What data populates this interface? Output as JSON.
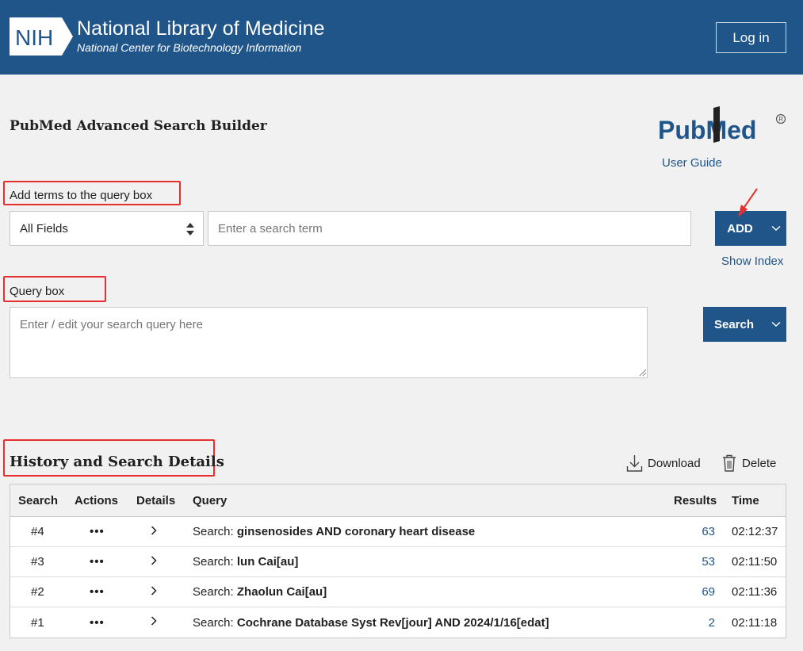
{
  "header": {
    "logo_text": "NIH",
    "title": "National Library of Medicine",
    "subtitle": "National Center for Biotechnology Information",
    "login_label": "Log in"
  },
  "page": {
    "title": "PubMed Advanced Search Builder",
    "logo_text": "PubMed",
    "user_guide_label": "User Guide"
  },
  "builder": {
    "add_terms_label": "Add terms to the query box",
    "field_value": "All Fields",
    "term_placeholder": "Enter a search term",
    "add_label": "ADD",
    "show_index_label": "Show Index",
    "query_box_label": "Query box",
    "query_placeholder": "Enter / edit your search query here",
    "search_label": "Search"
  },
  "history": {
    "title": "History and Search Details",
    "download_label": "Download",
    "delete_label": "Delete",
    "columns": [
      "Search",
      "Actions",
      "Details",
      "Query",
      "Results",
      "Time"
    ],
    "rows": [
      {
        "num": "#4",
        "actions": "•••",
        "prefix": "Search: ",
        "query": "ginsenosides AND coronary heart disease",
        "results": "63",
        "time": "02:12:37"
      },
      {
        "num": "#3",
        "actions": "•••",
        "prefix": "Search: ",
        "query": "lun Cai[au]",
        "results": "53",
        "time": "02:11:50"
      },
      {
        "num": "#2",
        "actions": "•••",
        "prefix": "Search: ",
        "query": "Zhaolun Cai[au]",
        "results": "69",
        "time": "02:11:36"
      },
      {
        "num": "#1",
        "actions": "•••",
        "prefix": "Search: ",
        "query": "Cochrane Database Syst Rev[jour] AND 2024/1/16[edat]",
        "results": "2",
        "time": "02:11:18"
      }
    ]
  },
  "colors": {
    "brand_blue": "#20558a",
    "annotation_red": "#e53030"
  }
}
